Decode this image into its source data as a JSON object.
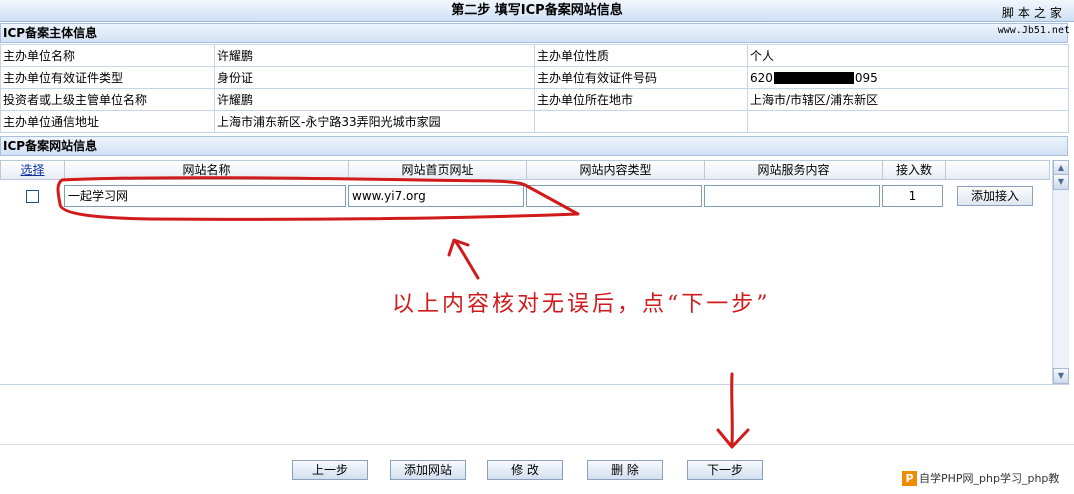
{
  "header": {
    "title": "第二步  填写ICP备案网站信息"
  },
  "watermark": {
    "line1": "脚本之家",
    "line2": "www.Jb51.net"
  },
  "subject_section": {
    "title": "ICP备案主体信息"
  },
  "subject_rows": [
    [
      "主办单位名称",
      "许耀鹏",
      "主办单位性质",
      "个人"
    ],
    [
      "主办单位有效证件类型",
      "身份证",
      "主办单位有效证件号码",
      "620"
    ],
    [
      "投资者或上级主管单位名称",
      "许耀鹏",
      "主办单位所在地市",
      "上海市/市辖区/浦东新区"
    ],
    [
      "主办单位通信地址",
      "上海市浦东新区-永宁路33弄阳光城市家园",
      "",
      ""
    ]
  ],
  "id_suffix": "095",
  "website_section": {
    "title": "ICP备案网站信息"
  },
  "grid": {
    "headers": [
      "选择",
      "网站名称",
      "网站首页网址",
      "网站内容类型",
      "网站服务内容",
      "接入数",
      ""
    ],
    "row": {
      "name": "一起学习网",
      "url": "www.yi7.org",
      "content_type": "",
      "service": "",
      "count": "1",
      "action": "添加接入"
    }
  },
  "buttons": {
    "prev": "上一步",
    "add_site": "添加网站",
    "edit": "修  改",
    "delete": "删  除",
    "next": "下一步"
  },
  "annotation": {
    "text": "以上内容核对无误后，点“下一步”",
    "color": "#d11a1a"
  },
  "bottom_watermark": {
    "text": "自学PHP网_php学习_php教"
  }
}
